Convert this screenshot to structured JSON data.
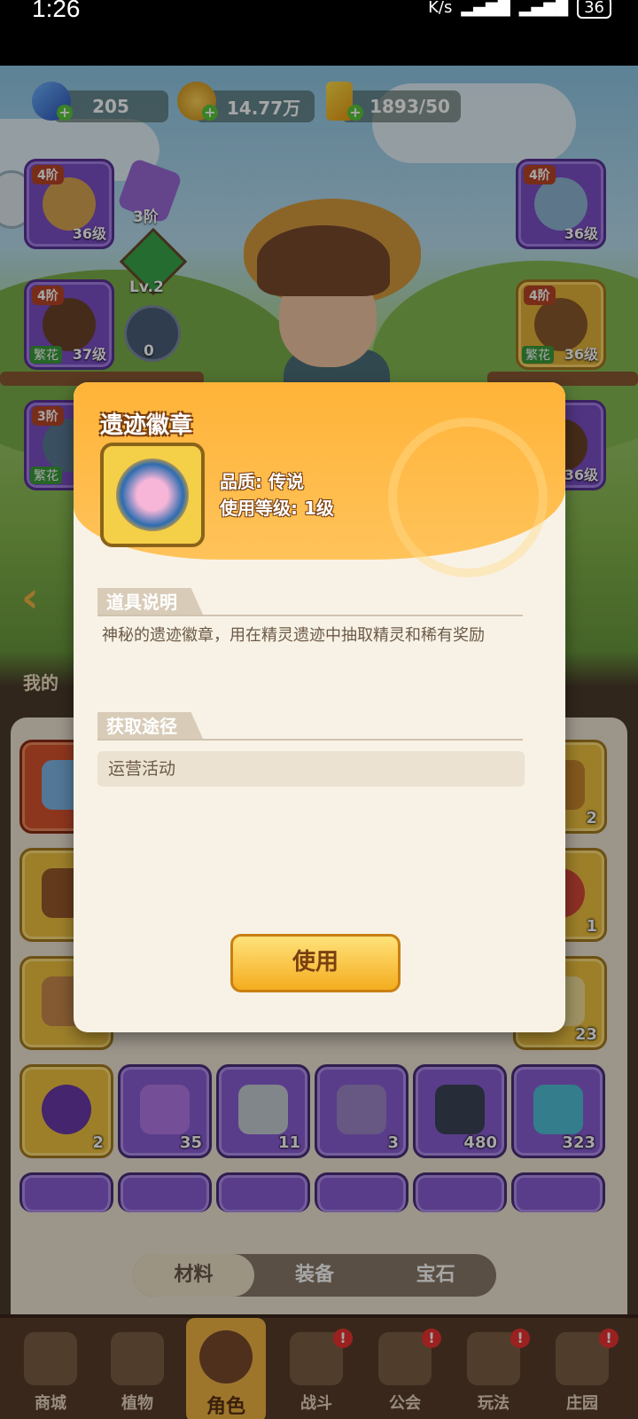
{
  "statusbar": {
    "time": "1:26",
    "network_unit": "K/s",
    "battery": "36"
  },
  "resources": {
    "diamonds": "205",
    "gold": "14.77万",
    "energy": "1893/50"
  },
  "equipment": {
    "left": [
      {
        "tier": "4阶",
        "level": "36级",
        "flourish": ""
      },
      {
        "tier": "4阶",
        "level": "37级",
        "flourish": "繁花"
      },
      {
        "tier": "3阶",
        "level": "",
        "flourish": "繁花"
      }
    ],
    "right": [
      {
        "tier": "4阶",
        "level": "36级",
        "flourish": ""
      },
      {
        "tier": "4阶",
        "level": "36级",
        "flourish": "繁花"
      },
      {
        "tier": "",
        "level": "36级",
        "flourish": ""
      }
    ],
    "middle": {
      "gem_tier": "3阶",
      "crystal_level": "Lv.2",
      "star_count": "0"
    }
  },
  "inventory": {
    "header": "我的",
    "row1_counts": [
      "",
      "",
      "",
      "",
      "",
      "2"
    ],
    "row2_counts": [
      "",
      "",
      "",
      "",
      "",
      "1"
    ],
    "row3_counts": [
      "",
      "",
      "",
      "",
      "",
      "23"
    ],
    "row4_counts": [
      "2",
      "35",
      "11",
      "3",
      "480",
      "323"
    ]
  },
  "tabs": [
    "材料",
    "装备",
    "宝石"
  ],
  "nav": [
    {
      "label": "商城",
      "badge": ""
    },
    {
      "label": "植物",
      "badge": ""
    },
    {
      "label": "角色",
      "badge": ""
    },
    {
      "label": "战斗",
      "badge": "!"
    },
    {
      "label": "公会",
      "badge": "!"
    },
    {
      "label": "玩法",
      "badge": "!"
    },
    {
      "label": "庄园",
      "badge": "!"
    }
  ],
  "dialog": {
    "title": "遗迹徽章",
    "quality": "品质: 传说",
    "use_level": "使用等级: 1级",
    "desc_header": "道具说明",
    "description": "神秘的遗迹徽章，用在精灵遗迹中抽取精灵和稀有奖励",
    "source_header": "获取途径",
    "source": "运营活动",
    "use_button": "使用"
  },
  "colors": {
    "accent_orange": "#ffb338",
    "button_yellow": "#f4ad1f",
    "item_purple": "#8a5fd4",
    "item_gold": "#f1c341"
  }
}
